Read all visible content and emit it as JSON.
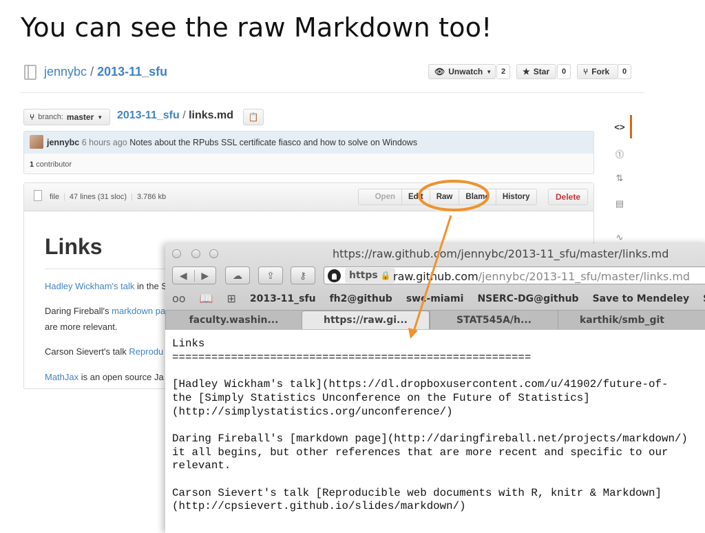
{
  "slide": {
    "title": "You can see the raw Markdown too!"
  },
  "repo": {
    "owner": "jennybc",
    "separator": "/",
    "name": "2013-11_sfu"
  },
  "actions": {
    "unwatch_label": "Unwatch",
    "unwatch_count": "2",
    "star_label": "Star",
    "star_count": "0",
    "fork_label": "Fork",
    "fork_count": "0"
  },
  "branch": {
    "prefix": "branch:",
    "name": "master"
  },
  "filepath": {
    "repo": "2013-11_sfu",
    "separator": "/",
    "file": "links.md"
  },
  "commit": {
    "author": "jennybc",
    "time": "6 hours ago",
    "message": "Notes about the RPubs SSL certificate fiasco and how to solve on Windows",
    "contributors_count": "1",
    "contributors_label": "contributor"
  },
  "file": {
    "type": "file",
    "lines": "47 lines (31 sloc)",
    "size": "3.786 kb",
    "buttons": {
      "open": "Open",
      "edit": "Edit",
      "raw": "Raw",
      "blame": "Blame",
      "history": "History",
      "delete": "Delete"
    }
  },
  "rendered": {
    "heading": "Links",
    "p1_link": "Hadley Wickham's talk",
    "p1_text": " in the S",
    "p2_text": "Daring Fireball's ",
    "p2_link": "markdown pa",
    "p2b_text": "are more relevant.",
    "p3_text": "Carson Sievert's talk ",
    "p3_link": "Reprodu",
    "p4_link": "MathJax",
    "p4_text": " is an open source Ja"
  },
  "browser": {
    "title": "https://raw.github.com/jennybc/2013-11_sfu/master/links.md",
    "https_label": "https",
    "url_domain": "raw.github.com",
    "url_path": "/jennybc/2013-11_sfu/master/links.md",
    "bookmarks": [
      "2013-11_sfu",
      "fh2@github",
      "swc-miami",
      "NSERC-DG@github",
      "Save to Mendeley",
      "S"
    ],
    "tabs": [
      "faculty.washin...",
      "https://raw.gi...",
      "STAT545A/h...",
      "karthik/smb_git"
    ],
    "raw_text": "Links\n=======================================================\n\n[Hadley Wickham's talk](https://dl.dropboxusercontent.com/u/41902/future-of-\nthe [Simply Statistics Unconference on the Future of Statistics]\n(http://simplystatistics.org/unconference/)\n\nDaring Fireball's [markdown page](http://daringfireball.net/projects/markdown/)\nit all begins, but other references that are more recent and specific to our\nrelevant.\n\nCarson Sievert's talk [Reproducible web documents with R, knitr & Markdown]\n(http://cpsievert.github.io/slides/markdown/)"
  },
  "colors": {
    "link": "#4183c4",
    "annotation": "#f0922e",
    "delete": "#cc3333",
    "rail_accent": "#d26911"
  },
  "icons": [
    "repo-icon",
    "eye-icon",
    "star-icon",
    "fork-icon",
    "branch-icon",
    "clipboard-icon",
    "code-icon",
    "issues-icon",
    "pull-request-icon",
    "wiki-icon",
    "pulse-icon",
    "file-icon",
    "github-logo-icon",
    "lock-icon",
    "cloud-icon",
    "share-icon",
    "key-icon",
    "glasses-icon",
    "book-icon",
    "grid-icon"
  ]
}
